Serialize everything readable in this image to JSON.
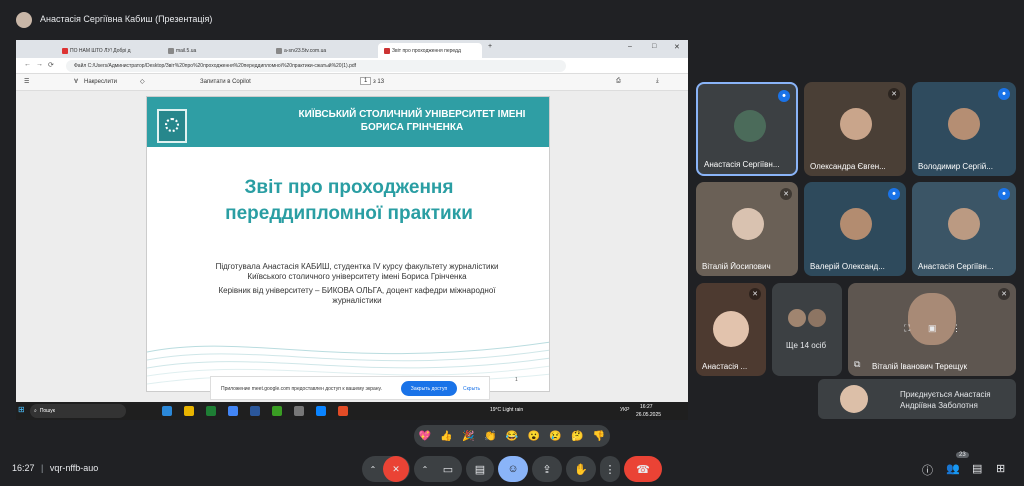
{
  "header": {
    "presenter_title": "Анастасія Сергіївна Кабиш (Презентація)"
  },
  "browser": {
    "tabs": [
      "ПО НАМ ШТО ЛУ! Добрі д",
      "mail.5.ua",
      "a-srv23.5tv.com.ua",
      "Звіт про проходження передд"
    ],
    "address": "Файл   C:/Users/Администратор/Desktop/Звіт%20про%20проходження%20переддипломної%20практики-сжатый%20(1).pdf",
    "pdf_toolbar": {
      "draw": "Накреслити",
      "copilot": "Запитати в Copilot",
      "page": "1",
      "of": "з 13"
    }
  },
  "slide": {
    "university": "КИЇВСЬКИЙ СТОЛИЧНИЙ УНІВЕРСИТЕТ ІМЕНІ БОРИСА ГРІНЧЕНКА",
    "title": "Звіт про проходження переддипломної практики",
    "prepared_by": "Підготувала Анастасія КАБИШ, студентка IV курсу факультету журналістики Київського столичного університету імені Бориса Грінченка",
    "supervisor": "Керівник від університету – БИКОВА ОЛЬГА, доцент кафедри міжнародної журналістики",
    "page_number": "1"
  },
  "share_notice": {
    "text": "Приложение meet.google.com предоставлен доступ к вашему экрану.",
    "button": "Закрыть доступ",
    "hide": "Скрыть"
  },
  "taskbar": {
    "search": "Пошук",
    "weather": "19°C  Light rain",
    "lang": "УКР",
    "clock": "16:27",
    "date": "26.05.2025"
  },
  "participants": [
    {
      "name": "Анастасія Сергіївн...",
      "mic": "on"
    },
    {
      "name": "Олександра Євген...",
      "mic": "off"
    },
    {
      "name": "Володимир Сергій...",
      "mic": "on"
    },
    {
      "name": "Віталій Йосипович",
      "mic": "off"
    },
    {
      "name": "Валерій Олександ...",
      "mic": "on"
    },
    {
      "name": "Анастасія Сергіївн...",
      "mic": "on"
    },
    {
      "name": "Анастасія ...",
      "mic": "off"
    },
    {
      "name": "Ще 14 осіб",
      "mic": ""
    },
    {
      "name": "Віталій Іванович Терещук",
      "mic": "off"
    }
  ],
  "join_notice": "Приєднується Анастасія Андріївна Заболотня",
  "reactions": [
    "💖",
    "👍",
    "🎉",
    "👏",
    "😂",
    "😮",
    "😢",
    "🤔",
    "👎"
  ],
  "bottom": {
    "time": "16:27",
    "meeting_code": "vqr-nffb-auo",
    "people_count": "23"
  },
  "colors": {
    "accent_teal": "#2f9ea4",
    "meet_red": "#ea4335",
    "meet_blue": "#1a73e8"
  }
}
